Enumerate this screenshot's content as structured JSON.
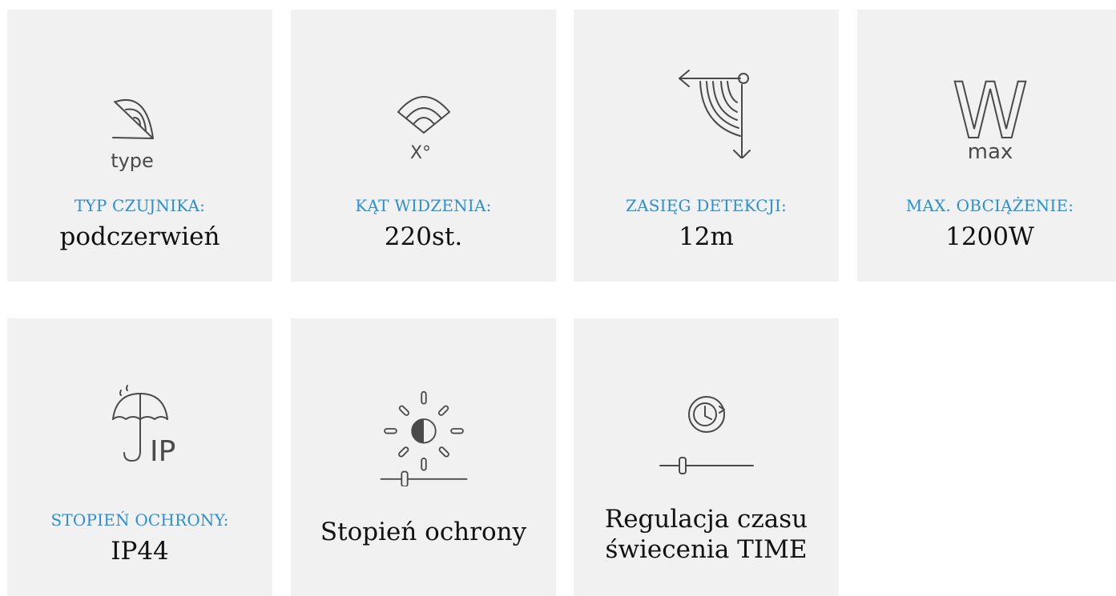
{
  "tiles": [
    {
      "icon": "sensor-type-icon",
      "label": "TYP CZUJNIKA:",
      "value": "podczerwień",
      "icon_text": "type"
    },
    {
      "icon": "viewing-angle-icon",
      "label": "KĄT WIDZENIA:",
      "value": "220st.",
      "icon_text": "X°"
    },
    {
      "icon": "detection-range-icon",
      "label": "ZASIĘG DETEKCJI:",
      "value": "12m"
    },
    {
      "icon": "max-load-icon",
      "label": "MAX. OBCIĄŻENIE:",
      "value": "1200W",
      "icon_text_big": "W",
      "icon_text": "max"
    },
    {
      "icon": "umbrella-ip-icon",
      "label": "STOPIEŃ OCHRONY:",
      "value": "IP44",
      "icon_text": "IP"
    },
    {
      "icon": "light-level-slider-icon",
      "desc_lines": [
        "Stopień ochrony"
      ]
    },
    {
      "icon": "time-slider-icon",
      "desc_lines": [
        "Regulacja czasu",
        "świecenia TIME"
      ]
    }
  ],
  "colors": {
    "tile_bg": "#f1f1f1",
    "label": "#2b8fd6",
    "value": "#111111",
    "icon": "#4a4a4a"
  }
}
